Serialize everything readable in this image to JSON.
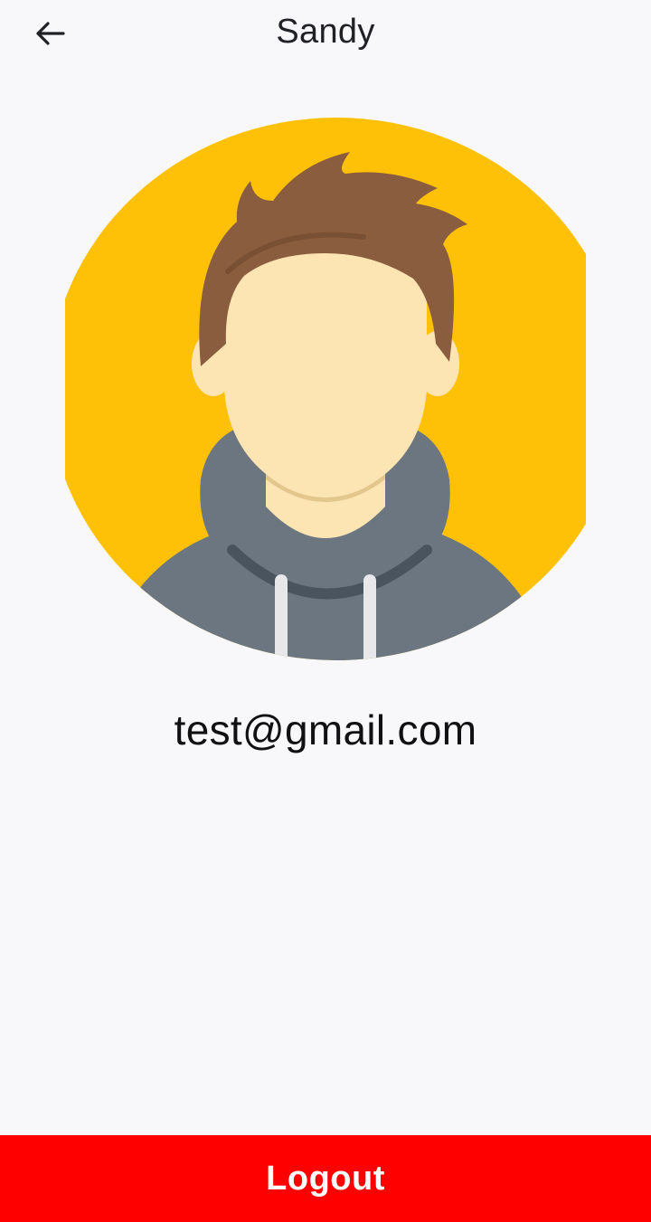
{
  "app_bar": {
    "back_icon": "arrow-left-icon",
    "title": "Sandy"
  },
  "profile": {
    "avatar_icon": "user-avatar-illustration",
    "email": "test@gmail.com"
  },
  "logout_button": {
    "label": "Logout"
  },
  "colors": {
    "background": "#f8f8fb",
    "avatar_circle": "#ffc107",
    "logout_button": "#ff0000",
    "logout_text": "#ffffff"
  }
}
